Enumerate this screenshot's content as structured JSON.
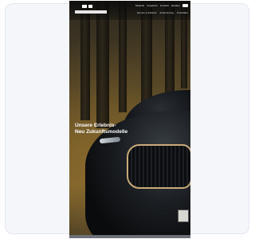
{
  "website": {
    "brand": "BMW",
    "nav": {
      "links": [
        "Modelle",
        "Angebote",
        "Kontakt",
        "Händler"
      ],
      "menu_label": "Menü"
    },
    "sub_nav": {
      "links": [
        "Service & Zubehör",
        "Finanzierung",
        "Probefahrt"
      ]
    },
    "hero": {
      "headline_lines": [
        "Unsere Erlebnis-",
        "Neu Zukunftsmodelle"
      ]
    }
  }
}
